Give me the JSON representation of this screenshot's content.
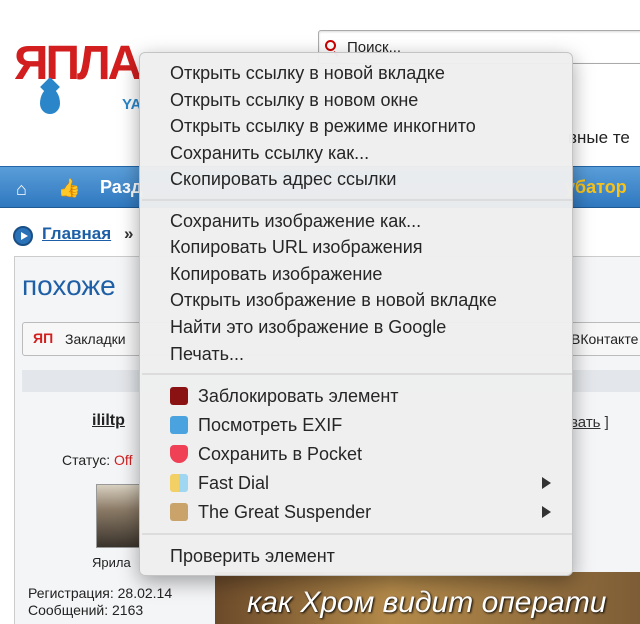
{
  "search": {
    "placeholder": "Поиск..."
  },
  "logo": {
    "text": "ЯПЛА",
    "subtext": "YA"
  },
  "header": {
    "right_fragment": "вные те"
  },
  "nav": {
    "section_label": "Разд",
    "incubator_label": "убатор"
  },
  "breadcrumb": {
    "home_label": "Главная",
    "separator": "»"
  },
  "page": {
    "title_fragment": "похоже"
  },
  "bookmarks_bar": {
    "logo": "ЯП",
    "bookmarks_label": "Закладки",
    "vk_label": "ВКонтакте"
  },
  "post": {
    "username": "ililtp",
    "reply_fragment": "вать",
    "reply_bracket": "]",
    "status_label": "Статус:",
    "status_value": "Off",
    "avatar_name": "Ярила",
    "registration": "Регистрация: 28.02.14",
    "messages": "Сообщений: 2163"
  },
  "banner": {
    "text": "как Хром видит операти"
  },
  "menu": {
    "group1": [
      "Открыть ссылку в новой вкладке",
      "Открыть ссылку в новом окне",
      "Открыть ссылку в режиме инкогнито",
      "Сохранить ссылку как...",
      "Скопировать адрес ссылки"
    ],
    "group2": [
      "Сохранить изображение как...",
      "Копировать URL изображения",
      "Копировать изображение",
      "Открыть изображение в новой вкладке",
      "Найти это изображение в Google",
      "Печать..."
    ],
    "extensions": [
      {
        "label": "Заблокировать элемент",
        "icon": "ublock-icon",
        "color": "#8b1212"
      },
      {
        "label": "Посмотреть EXIF",
        "icon": "camera-icon",
        "color": "#4aa3df"
      },
      {
        "label": "Сохранить в Pocket",
        "icon": "pocket-icon",
        "color": "#ef4056"
      },
      {
        "label": "Fast Dial",
        "icon": "fast-dial-icon",
        "color": "#f2d066"
      },
      {
        "label": "The Great Suspender",
        "icon": "suspender-icon",
        "color": "#c9a36a"
      }
    ],
    "inspect": "Проверить элемент"
  }
}
